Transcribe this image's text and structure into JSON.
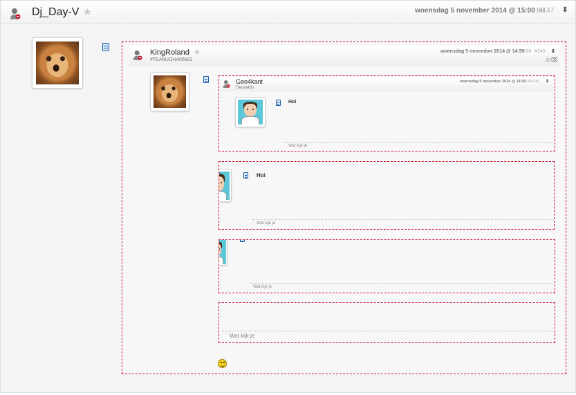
{
  "post": {
    "username": "Dj_Day-V",
    "date_main": "woensdag 5 november 2014 @ 15:00",
    "date_sec": ":09",
    "post_number": "#147"
  },
  "quote1": {
    "username": "KingRoland",
    "subtitle": "#TEAMJOHANNES",
    "date_main": "woensdag 5 november 2014 @ 14:59",
    "date_sec": ":06",
    "post_number": "#145",
    "actions": "⚠⌫"
  },
  "quote2": {
    "username": "Geo4kant",
    "subtitle": "Geonaldo",
    "date_main": "woensdag 5 november 2014 @ 14:55",
    "date_sec": ":08",
    "post_number": "#140",
    "message": "Hoi",
    "signature": "Wat kijk je"
  },
  "quote3": {
    "message": "Hoi",
    "signature": "Wat kijk je"
  },
  "quote4": {
    "signature": "Wat kijk je"
  },
  "quote5": {
    "signature": "Wat kijk je"
  },
  "icons": {
    "star": "star-icon",
    "arrows": "⇕"
  },
  "colors": {
    "quote_border": "#c8102e",
    "doc_icon": "#1a5fa8"
  }
}
